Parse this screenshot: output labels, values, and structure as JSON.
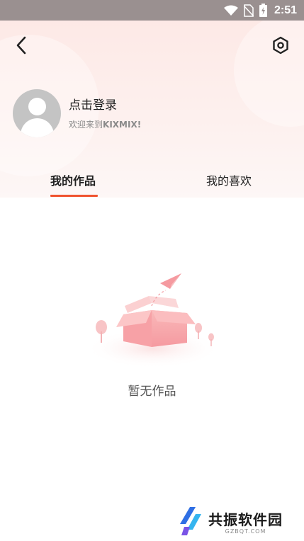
{
  "status_bar": {
    "time": "2:51",
    "icons": [
      "wifi-icon",
      "no-sim-icon",
      "battery-charging-icon"
    ]
  },
  "header": {
    "back_icon": "chevron-left-icon",
    "settings_icon": "hexagon-settings-icon"
  },
  "profile": {
    "login_label": "点击登录",
    "welcome_prefix": "欢迎来到",
    "welcome_brand": "KIXMIX!"
  },
  "tabs": [
    {
      "label": "我的作品",
      "active": true
    },
    {
      "label": "我的喜欢",
      "active": false
    }
  ],
  "empty_state": {
    "text": "暂无作品",
    "illustration": "open-box-with-paper-plane"
  },
  "watermark": {
    "name": "共振软件园",
    "domain": "GZBQT.COM"
  },
  "colors": {
    "accent": "#f0532f",
    "status_bar": "#9a9090",
    "header_tint": "#fde9e6",
    "box_pink": "#f7a7aa"
  }
}
